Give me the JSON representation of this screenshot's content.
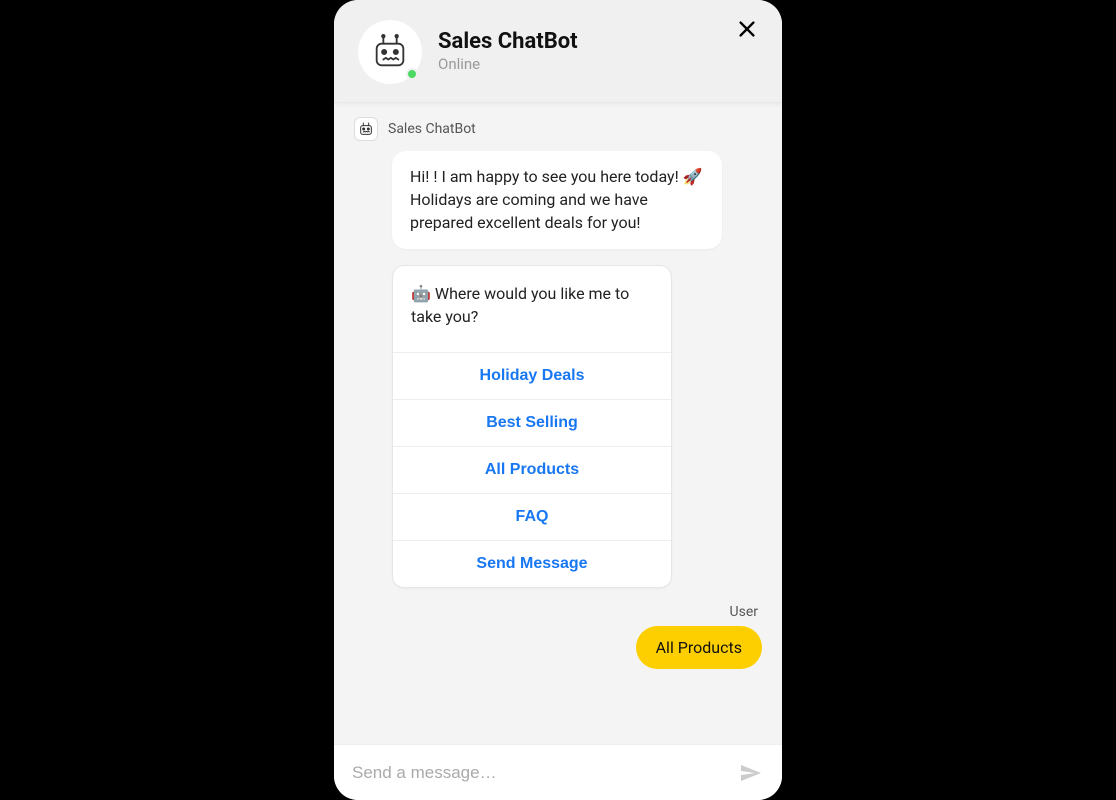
{
  "header": {
    "title": "Sales ChatBot",
    "status": "Online"
  },
  "bot": {
    "name": "Sales ChatBot",
    "greeting": "Hi! ! I am happy to see you here today! 🚀 Holidays are coming and we have prepared excellent deals for you!",
    "prompt": "🤖 Where would you like me to take you?",
    "options": [
      "Holiday Deals",
      "Best Selling",
      "All Products",
      "FAQ",
      "Send Message"
    ]
  },
  "user": {
    "label": "User",
    "message": "All Products"
  },
  "composer": {
    "placeholder": "Send a message…",
    "value": ""
  }
}
